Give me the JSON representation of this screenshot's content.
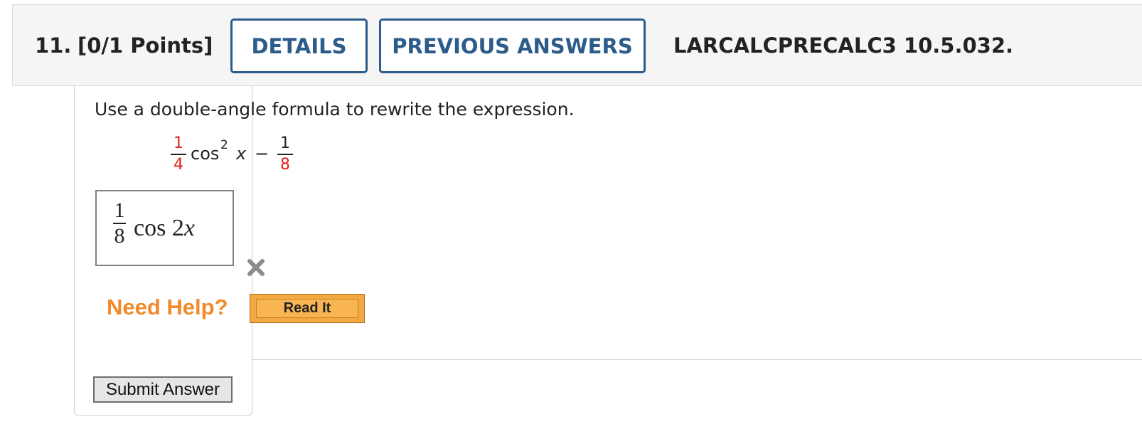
{
  "header": {
    "question_number": "11.",
    "points": "[0/1 Points]",
    "details_label": "DETAILS",
    "previous_answers_label": "PREVIOUS ANSWERS",
    "reference": "LARCALCPRECALC3 10.5.032."
  },
  "question": {
    "prompt": "Use a double-angle formula to rewrite the expression.",
    "expression": {
      "coef_numerator": "1",
      "coef_denominator": "4",
      "func": "cos",
      "exponent": "2",
      "variable": "x",
      "operator": "−",
      "const_numerator": "1",
      "const_denominator": "8",
      "highlight_color": "#e02020"
    }
  },
  "answer": {
    "numerator": "1",
    "denominator": "8",
    "func": "cos",
    "argument_coef": "2",
    "argument_var": "x",
    "status_icon": "incorrect-x-icon"
  },
  "help": {
    "label": "Need Help?",
    "read_it_label": "Read It"
  },
  "submit": {
    "label": "Submit Answer"
  },
  "colors": {
    "header_button": "#2b5c8a",
    "need_help": "#f08a2a",
    "read_it": "#f3a941"
  }
}
